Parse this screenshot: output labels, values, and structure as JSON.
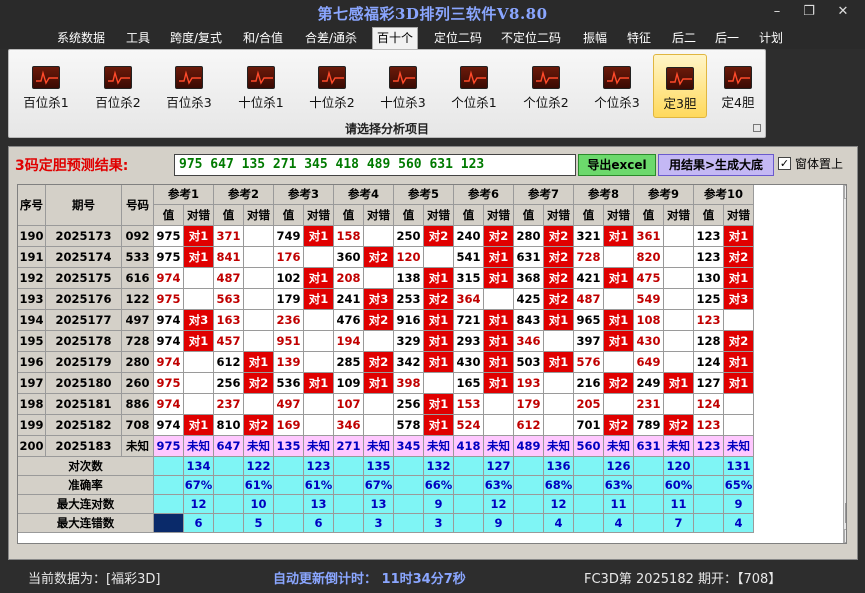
{
  "window": {
    "title": "第七感福彩3D排列三软件V8.80",
    "min_icon": "minimize-icon",
    "max_icon": "maximize-icon",
    "close_icon": "close-icon"
  },
  "menu": [
    "系统数据",
    "工具",
    "跨度/复式",
    "和/合值",
    "合差/通杀",
    "百十个",
    "定位二码",
    "不定位二码",
    "振幅",
    "特征",
    "后二",
    "后一",
    "计划"
  ],
  "menu_active": "百十个",
  "ribbon": {
    "tools": [
      "百位杀1",
      "百位杀2",
      "百位杀3",
      "十位杀1",
      "十位杀2",
      "十位杀3",
      "个位杀1",
      "个位杀2",
      "个位杀3",
      "定3胆",
      "定4胆"
    ],
    "selected": "定3胆",
    "caption": "请选择分析项目"
  },
  "prediction": {
    "label": "3码定胆预测结果:",
    "value": "975 647 135 271 345 418 489 560 631 123",
    "export_button": "导出excel",
    "big_button": "用结果>生成大底",
    "topmost_checked": "✓",
    "topmost_label": "窗体置上"
  },
  "table": {
    "headers": {
      "seq": "序号",
      "period": "期号",
      "code": "号码",
      "val": "值",
      "hit": "对错"
    },
    "refs": [
      "参考1",
      "参考2",
      "参考3",
      "参考4",
      "参考5",
      "参考6",
      "参考7",
      "参考8",
      "参考9",
      "参考10"
    ],
    "rows": [
      {
        "seq": "190",
        "period": "2025173",
        "code": "092",
        "cells": [
          [
            "975",
            "对1"
          ],
          [
            "371",
            ""
          ],
          [
            "749",
            "对1"
          ],
          [
            "158",
            ""
          ],
          [
            "250",
            "对2"
          ],
          [
            "240",
            "对2"
          ],
          [
            "280",
            "对2"
          ],
          [
            "321",
            "对1"
          ],
          [
            "361",
            ""
          ],
          [
            "123",
            "对1"
          ]
        ]
      },
      {
        "seq": "191",
        "period": "2025174",
        "code": "533",
        "cells": [
          [
            "975",
            "对1"
          ],
          [
            "841",
            ""
          ],
          [
            "176",
            ""
          ],
          [
            "360",
            "对2"
          ],
          [
            "120",
            ""
          ],
          [
            "541",
            "对1"
          ],
          [
            "631",
            "对2"
          ],
          [
            "728",
            ""
          ],
          [
            "820",
            ""
          ],
          [
            "123",
            "对2"
          ]
        ]
      },
      {
        "seq": "192",
        "period": "2025175",
        "code": "616",
        "cells": [
          [
            "974",
            ""
          ],
          [
            "487",
            ""
          ],
          [
            "102",
            "对1"
          ],
          [
            "208",
            ""
          ],
          [
            "138",
            "对1"
          ],
          [
            "315",
            "对1"
          ],
          [
            "368",
            "对2"
          ],
          [
            "421",
            "对1"
          ],
          [
            "475",
            ""
          ],
          [
            "130",
            "对1"
          ]
        ]
      },
      {
        "seq": "193",
        "period": "2025176",
        "code": "122",
        "cells": [
          [
            "975",
            ""
          ],
          [
            "563",
            ""
          ],
          [
            "179",
            "对1"
          ],
          [
            "241",
            "对3"
          ],
          [
            "253",
            "对2"
          ],
          [
            "364",
            ""
          ],
          [
            "425",
            "对2"
          ],
          [
            "487",
            ""
          ],
          [
            "549",
            ""
          ],
          [
            "125",
            "对3"
          ]
        ]
      },
      {
        "seq": "194",
        "period": "2025177",
        "code": "497",
        "cells": [
          [
            "974",
            "对3"
          ],
          [
            "163",
            ""
          ],
          [
            "236",
            ""
          ],
          [
            "476",
            "对2"
          ],
          [
            "916",
            "对1"
          ],
          [
            "721",
            "对1"
          ],
          [
            "843",
            "对1"
          ],
          [
            "965",
            "对1"
          ],
          [
            "108",
            ""
          ],
          [
            "123",
            ""
          ]
        ]
      },
      {
        "seq": "195",
        "period": "2025178",
        "code": "728",
        "cells": [
          [
            "974",
            "对1"
          ],
          [
            "457",
            ""
          ],
          [
            "951",
            ""
          ],
          [
            "194",
            ""
          ],
          [
            "329",
            "对1"
          ],
          [
            "293",
            "对1"
          ],
          [
            "346",
            ""
          ],
          [
            "397",
            "对1"
          ],
          [
            "430",
            ""
          ],
          [
            "128",
            "对2"
          ]
        ]
      },
      {
        "seq": "196",
        "period": "2025179",
        "code": "280",
        "cells": [
          [
            "974",
            ""
          ],
          [
            "612",
            "对1"
          ],
          [
            "139",
            ""
          ],
          [
            "285",
            "对2"
          ],
          [
            "342",
            "对1"
          ],
          [
            "430",
            "对1"
          ],
          [
            "503",
            "对1"
          ],
          [
            "576",
            ""
          ],
          [
            "649",
            ""
          ],
          [
            "124",
            "对1"
          ]
        ]
      },
      {
        "seq": "197",
        "period": "2025180",
        "code": "260",
        "cells": [
          [
            "975",
            ""
          ],
          [
            "256",
            "对2"
          ],
          [
            "536",
            "对1"
          ],
          [
            "109",
            "对1"
          ],
          [
            "398",
            ""
          ],
          [
            "165",
            "对1"
          ],
          [
            "193",
            ""
          ],
          [
            "216",
            "对2"
          ],
          [
            "249",
            "对1"
          ],
          [
            "127",
            "对1"
          ]
        ]
      },
      {
        "seq": "198",
        "period": "2025181",
        "code": "886",
        "cells": [
          [
            "974",
            ""
          ],
          [
            "237",
            ""
          ],
          [
            "497",
            ""
          ],
          [
            "107",
            ""
          ],
          [
            "256",
            "对1"
          ],
          [
            "153",
            ""
          ],
          [
            "179",
            ""
          ],
          [
            "205",
            ""
          ],
          [
            "231",
            ""
          ],
          [
            "124",
            ""
          ]
        ]
      },
      {
        "seq": "199",
        "period": "2025182",
        "code": "708",
        "cells": [
          [
            "974",
            "对1"
          ],
          [
            "810",
            "对2"
          ],
          [
            "169",
            ""
          ],
          [
            "346",
            ""
          ],
          [
            "578",
            "对1"
          ],
          [
            "524",
            ""
          ],
          [
            "612",
            ""
          ],
          [
            "701",
            "对2"
          ],
          [
            "789",
            "对2"
          ],
          [
            "123",
            ""
          ]
        ]
      },
      {
        "seq": "200",
        "period": "2025183",
        "code": "未知",
        "cells": [
          [
            "975",
            "未知"
          ],
          [
            "647",
            "未知"
          ],
          [
            "135",
            "未知"
          ],
          [
            "271",
            "未知"
          ],
          [
            "345",
            "未知"
          ],
          [
            "418",
            "未知"
          ],
          [
            "489",
            "未知"
          ],
          [
            "560",
            "未知"
          ],
          [
            "631",
            "未知"
          ],
          [
            "123",
            "未知"
          ]
        ]
      }
    ],
    "stats": [
      {
        "label": "对次数",
        "values": [
          "134",
          "122",
          "123",
          "135",
          "132",
          "127",
          "136",
          "126",
          "120",
          "131"
        ]
      },
      {
        "label": "准确率",
        "values": [
          "67%",
          "61%",
          "61%",
          "67%",
          "66%",
          "63%",
          "68%",
          "63%",
          "60%",
          "65%"
        ]
      },
      {
        "label": "最大连对数",
        "values": [
          "12",
          "10",
          "13",
          "13",
          "9",
          "12",
          "12",
          "11",
          "11",
          "9"
        ]
      },
      {
        "label": "最大连错数",
        "values": [
          "6",
          "5",
          "6",
          "3",
          "3",
          "9",
          "4",
          "4",
          "7",
          "4"
        ]
      }
    ],
    "colors": {
      "hit_bg": "#e00000",
      "miss_text": "#c00000",
      "stat_bg": "#7ff5f5",
      "future_bg": "#ffc8ff",
      "header_bg": "#d4d0c8"
    }
  },
  "status": {
    "current": "当前数据为：[福彩3D]",
    "countdown": "自动更新倒计时：  11时34分7秒",
    "issue": "FC3D第 2025182 期开：【708】"
  }
}
